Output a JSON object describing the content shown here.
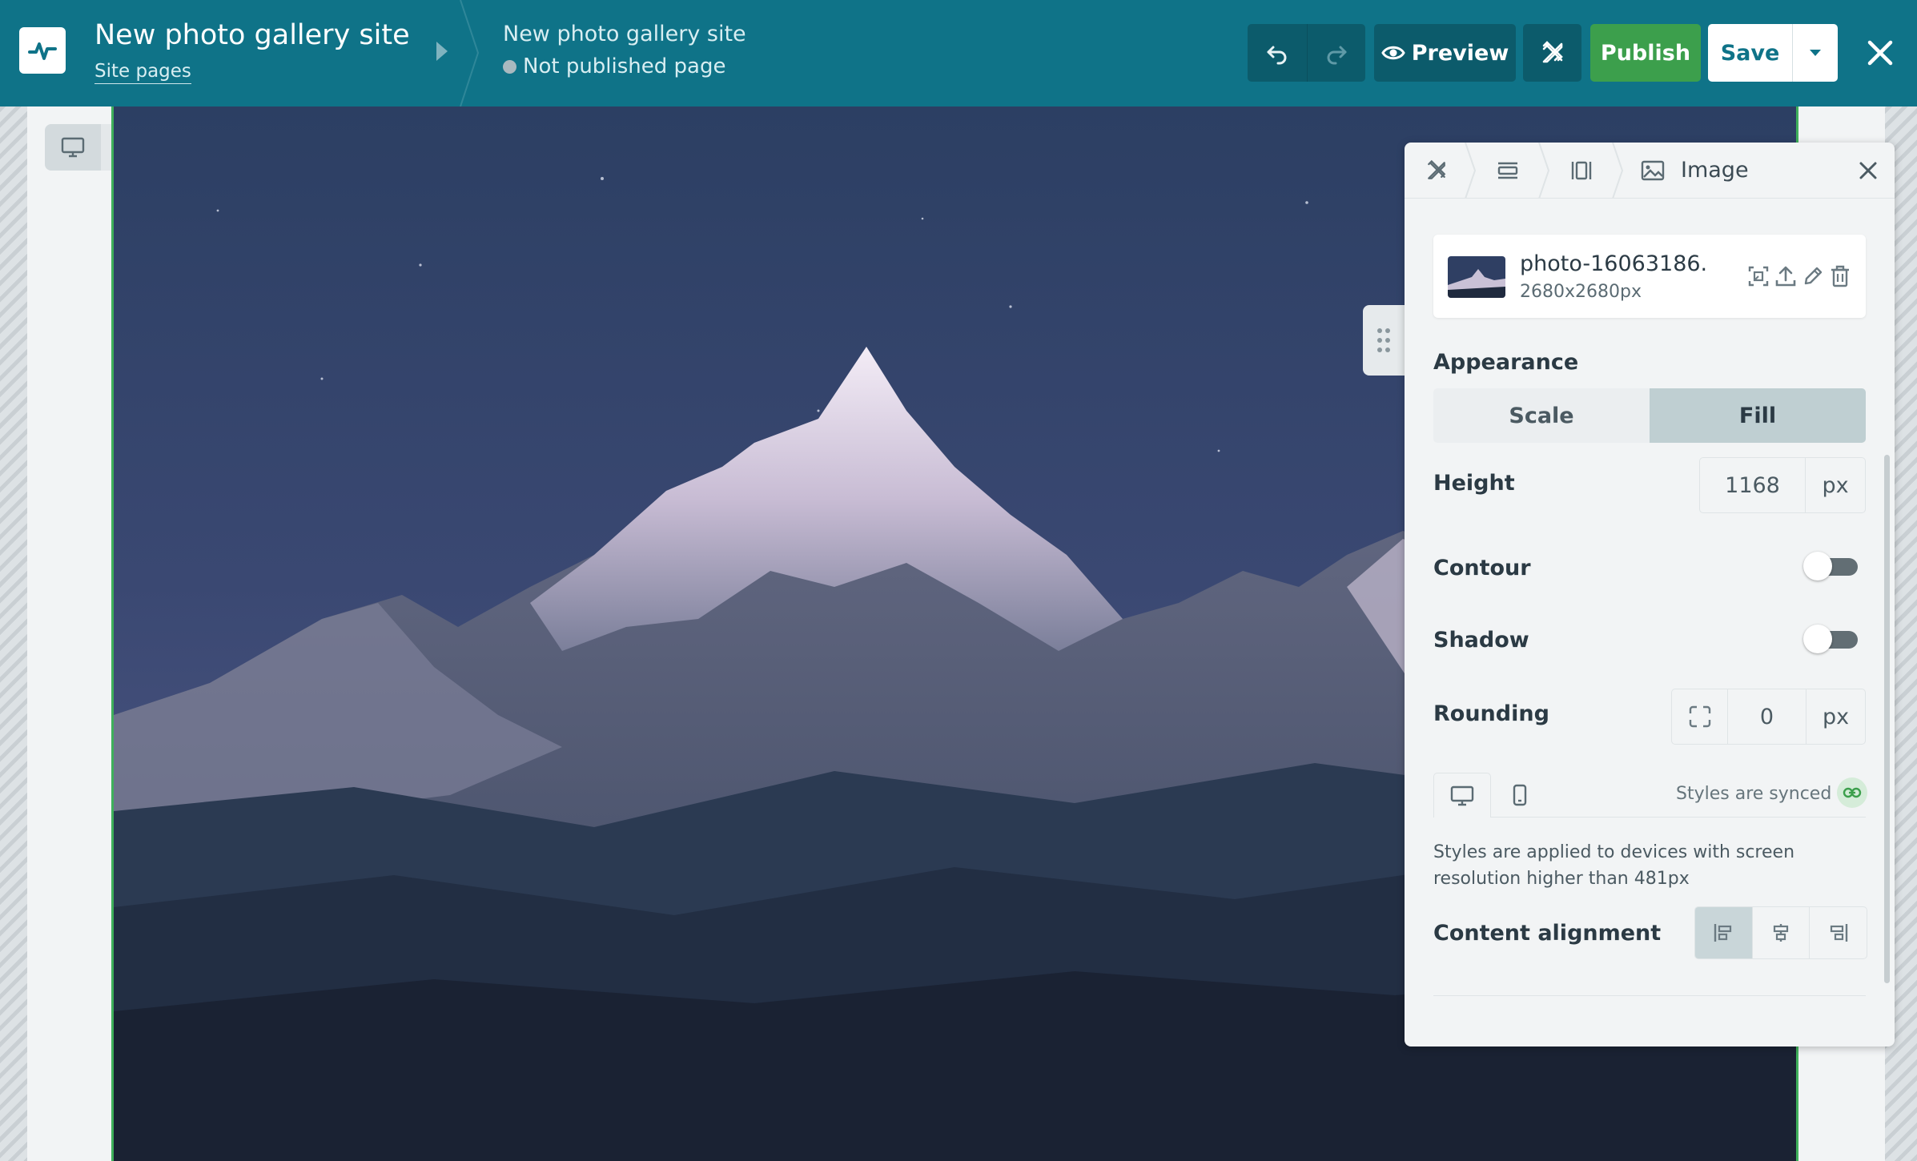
{
  "header": {
    "site_title": "New photo gallery site",
    "site_pages_link": "Site pages",
    "page_name": "New photo gallery site",
    "page_status": "Not published page",
    "preview_label": "Preview",
    "publish_label": "Publish",
    "save_label": "Save"
  },
  "panel": {
    "title": "Image",
    "file": {
      "name": "photo-16063186...",
      "dimensions": "2680x2680px"
    },
    "appearance": {
      "label": "Appearance",
      "options": [
        "Scale",
        "Fill"
      ],
      "selected": "Fill"
    },
    "height": {
      "label": "Height",
      "value": "1168",
      "unit": "px"
    },
    "contour": {
      "label": "Contour",
      "enabled": false
    },
    "shadow": {
      "label": "Shadow",
      "enabled": false
    },
    "rounding": {
      "label": "Rounding",
      "value": "0",
      "unit": "px"
    },
    "styles_synced": "Styles are synced",
    "device_note": "Styles are applied to devices with screen resolution higher than 481px",
    "content_alignment": {
      "label": "Content alignment",
      "selected": "left"
    }
  },
  "colors": {
    "topbar": "#0f7388",
    "publish": "#3c9f4c",
    "selection_outline": "#3fb05b",
    "segment_active": "#bfcfd2"
  },
  "icons": [
    "logo-icon",
    "chevron-right-icon",
    "undo-icon",
    "redo-icon",
    "eye-icon",
    "design-tools-icon",
    "chevron-down-icon",
    "close-icon",
    "desktop-icon",
    "mobile-icon",
    "drag-handle-icon",
    "section-icon",
    "column-icon",
    "image-icon",
    "crop-icon",
    "upload-icon",
    "pencil-icon",
    "trash-icon",
    "rounding-corners-icon",
    "link-icon",
    "align-left-icon",
    "align-center-icon",
    "align-right-icon"
  ]
}
